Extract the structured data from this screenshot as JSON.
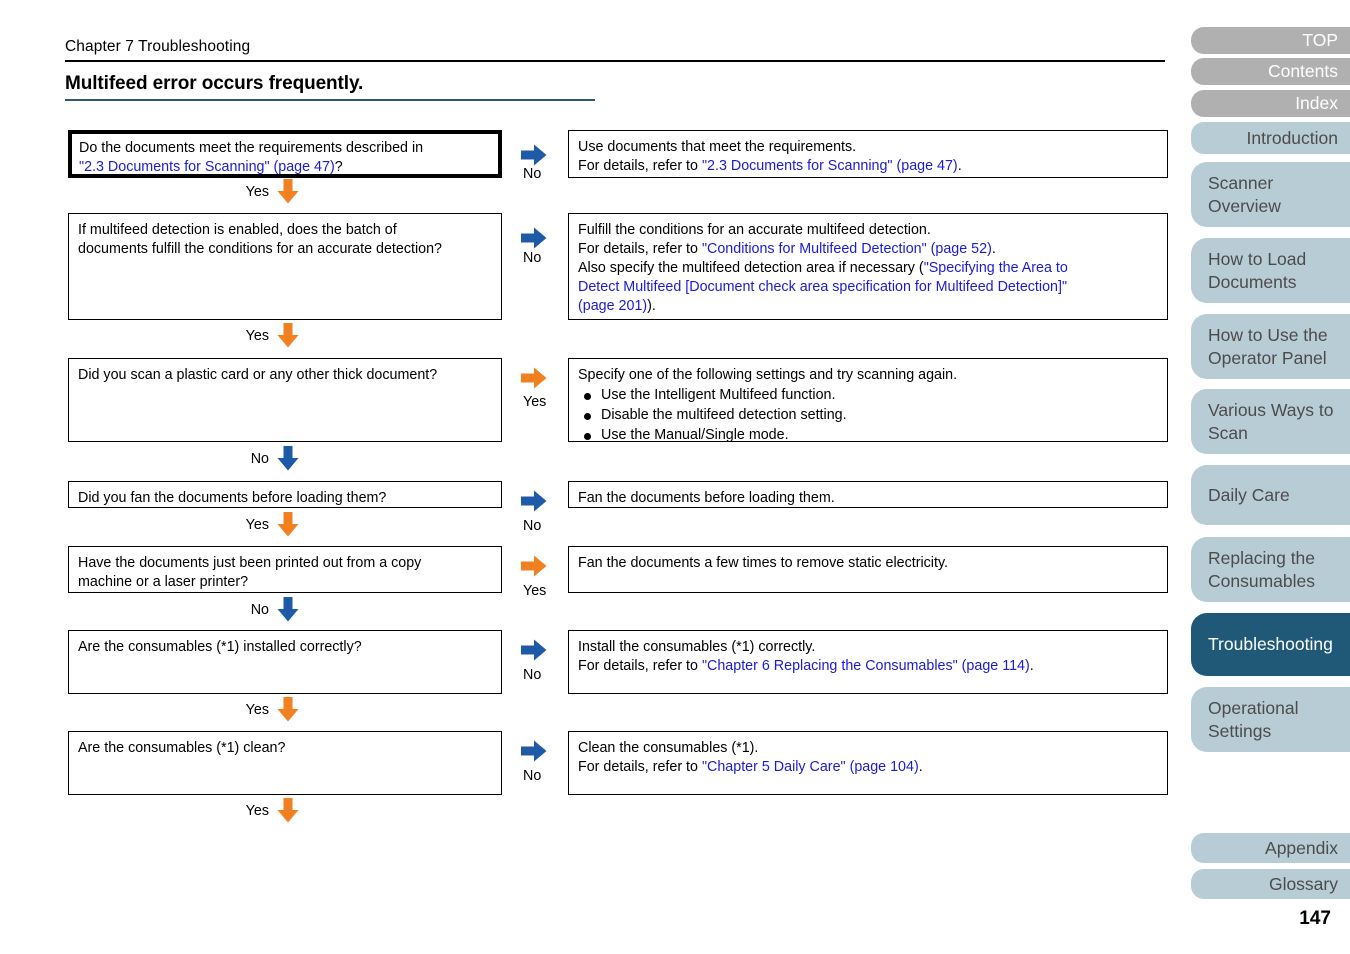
{
  "header": {
    "chapter": "Chapter 7 Troubleshooting",
    "title": "Multifeed error occurs frequently."
  },
  "page_number": "147",
  "colors": {
    "title_rule": "#31576c",
    "link": "#1b1bd4",
    "arrow_blue": "#1f5aa8",
    "arrow_orange": "#f08020",
    "tab_gray": "#b0b0b0",
    "tab_blue": "#b8ccd6",
    "tab_selected": "#1f5977"
  },
  "flow": {
    "questions": [
      {
        "id": "q1",
        "lines": [
          {
            "segments": [
              {
                "text": "Do the documents meet the requirements described in",
                "link": false
              }
            ]
          },
          {
            "segments": [
              {
                "text": "\"2.3 Documents for Scanning\" (page 47)",
                "link": true
              },
              {
                "text": "?",
                "link": false
              }
            ]
          }
        ],
        "branch_down_label": "Yes",
        "branch_down_color": "orange",
        "branch_right_label": "No",
        "branch_right_color": "blue"
      },
      {
        "id": "q2",
        "lines": [
          {
            "segments": [
              {
                "text": "If multifeed detection is enabled, does the batch of",
                "link": false
              }
            ]
          },
          {
            "segments": [
              {
                "text": "documents fulfill the conditions for an accurate detection?",
                "link": false
              }
            ]
          }
        ],
        "branch_down_label": "Yes",
        "branch_down_color": "orange",
        "branch_right_label": "No",
        "branch_right_color": "blue"
      },
      {
        "id": "q3",
        "lines": [
          {
            "segments": [
              {
                "text": "Did you scan a plastic card or any other thick document?",
                "link": false
              }
            ]
          }
        ],
        "branch_down_label": "No",
        "branch_down_color": "blue",
        "branch_right_label": "Yes",
        "branch_right_color": "orange"
      },
      {
        "id": "q4",
        "lines": [
          {
            "segments": [
              {
                "text": "Did you fan the documents before loading them?",
                "link": false
              }
            ]
          }
        ],
        "branch_down_label": "Yes",
        "branch_down_color": "orange",
        "branch_right_label": "No",
        "branch_right_color": "blue"
      },
      {
        "id": "q5",
        "lines": [
          {
            "segments": [
              {
                "text": "Have the documents just been printed out from a copy",
                "link": false
              }
            ]
          },
          {
            "segments": [
              {
                "text": "machine or a laser printer?",
                "link": false
              }
            ]
          }
        ],
        "branch_down_label": "No",
        "branch_down_color": "blue",
        "branch_right_label": "Yes",
        "branch_right_color": "orange"
      },
      {
        "id": "q6",
        "lines": [
          {
            "segments": [
              {
                "text": "Are the consumables (*1) installed correctly?",
                "link": false
              }
            ]
          }
        ],
        "branch_down_label": "Yes",
        "branch_down_color": "orange",
        "branch_right_label": "No",
        "branch_right_color": "blue"
      },
      {
        "id": "q7",
        "lines": [
          {
            "segments": [
              {
                "text": "Are the consumables (*1) clean?",
                "link": false
              }
            ]
          }
        ],
        "branch_down_label": "Yes",
        "branch_down_color": "orange",
        "branch_right_label": "No",
        "branch_right_color": "blue"
      }
    ],
    "answers": [
      {
        "id": "a1",
        "lines": [
          {
            "segments": [
              {
                "text": "Use documents that meet the requirements.",
                "link": false
              }
            ]
          },
          {
            "segments": [
              {
                "text": "For details, refer to ",
                "link": false
              },
              {
                "text": "\"2.3 Documents for Scanning\" (page 47)",
                "link": true
              },
              {
                "text": ".",
                "link": false
              }
            ]
          }
        ]
      },
      {
        "id": "a2",
        "lines": [
          {
            "segments": [
              {
                "text": "Fulfill the conditions for an accurate multifeed detection.",
                "link": false
              }
            ]
          },
          {
            "segments": [
              {
                "text": "For details, refer to ",
                "link": false
              },
              {
                "text": "\"Conditions for Multifeed Detection\" (page 52)",
                "link": true
              },
              {
                "text": ".",
                "link": false
              }
            ]
          },
          {
            "segments": [
              {
                "text": "Also specify the multifeed detection area if necessary (",
                "link": false
              },
              {
                "text": "\"Specifying the Area to",
                "link": true
              }
            ]
          },
          {
            "segments": [
              {
                "text": "Detect Multifeed [Document check area specification for Multifeed Detection]\"",
                "link": true
              }
            ]
          },
          {
            "segments": [
              {
                "text": "(page 201)",
                "link": true
              },
              {
                "text": ").",
                "link": false
              }
            ]
          }
        ]
      },
      {
        "id": "a3",
        "intro": "Specify one of the following settings and try scanning again.",
        "bullets": [
          "Use the Intelligent Multifeed function.",
          "Disable the multifeed detection setting.",
          "Use the Manual/Single mode."
        ]
      },
      {
        "id": "a4",
        "lines": [
          {
            "segments": [
              {
                "text": "Fan the documents before loading them.",
                "link": false
              }
            ]
          }
        ]
      },
      {
        "id": "a5",
        "lines": [
          {
            "segments": [
              {
                "text": "Fan the documents a few times to remove static electricity.",
                "link": false
              }
            ]
          }
        ]
      },
      {
        "id": "a6",
        "lines": [
          {
            "segments": [
              {
                "text": "Install the consumables (*1) correctly.",
                "link": false
              }
            ]
          },
          {
            "segments": [
              {
                "text": "For details, refer to ",
                "link": false
              },
              {
                "text": "\"Chapter 6 Replacing the Consumables\" (page 114)",
                "link": true
              },
              {
                "text": ".",
                "link": false
              }
            ]
          }
        ]
      },
      {
        "id": "a7",
        "lines": [
          {
            "segments": [
              {
                "text": "Clean the consumables (*1).",
                "link": false
              }
            ]
          },
          {
            "segments": [
              {
                "text": "For details, refer to ",
                "link": false
              },
              {
                "text": "\"Chapter 5 Daily Care\" (page 104)",
                "link": true
              },
              {
                "text": ".",
                "link": false
              }
            ]
          }
        ]
      }
    ]
  },
  "sidebar": {
    "items": [
      {
        "label": "TOP",
        "style": "gray",
        "multi": false,
        "selected": false
      },
      {
        "label": "Contents",
        "style": "gray",
        "multi": false,
        "selected": false
      },
      {
        "label": "Index",
        "style": "gray",
        "multi": false,
        "selected": false
      },
      {
        "label": "Introduction",
        "style": "blue",
        "multi": false,
        "selected": false
      },
      {
        "label": "Scanner\nOverview",
        "style": "blue",
        "multi": true,
        "selected": false
      },
      {
        "label": "How to Load\nDocuments",
        "style": "blue",
        "multi": true,
        "selected": false
      },
      {
        "label": "How to Use the\nOperator Panel",
        "style": "blue",
        "multi": true,
        "selected": false
      },
      {
        "label": "Various Ways to\nScan",
        "style": "blue",
        "multi": true,
        "selected": false
      },
      {
        "label": "Daily Care",
        "style": "blue",
        "multi": true,
        "selected": false
      },
      {
        "label": "Replacing the\nConsumables",
        "style": "blue",
        "multi": true,
        "selected": false
      },
      {
        "label": "Troubleshooting",
        "style": "sel",
        "multi": true,
        "selected": true
      },
      {
        "label": "Operational\nSettings",
        "style": "blue",
        "multi": true,
        "selected": false
      },
      {
        "label": "Appendix",
        "style": "blue",
        "multi": false,
        "selected": false
      },
      {
        "label": "Glossary",
        "style": "blue",
        "multi": false,
        "selected": false
      }
    ]
  }
}
